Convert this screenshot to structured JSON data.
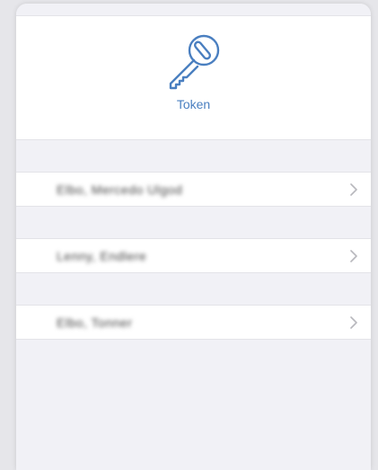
{
  "header": {
    "icon": "key-icon",
    "label": "Token",
    "accent_color": "#4a7fc0"
  },
  "accounts": [
    {
      "label": "Elbo, Mercedo Ulgod",
      "chevron": "chevron-right-icon"
    },
    {
      "label": "Lenny, Endlere",
      "chevron": "chevron-right-icon"
    },
    {
      "label": "Elbo, Tonner",
      "chevron": "chevron-right-icon"
    }
  ]
}
